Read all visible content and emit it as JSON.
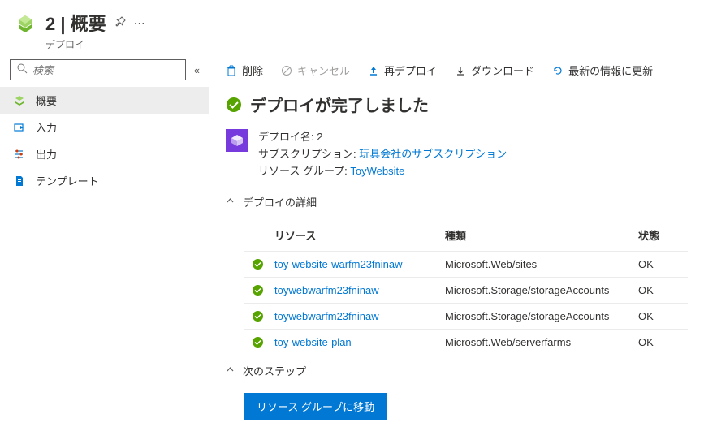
{
  "header": {
    "title": "2 | 概要",
    "subtitle": "デプロイ"
  },
  "search": {
    "placeholder": "検索"
  },
  "sidebar": {
    "items": [
      {
        "label": "概要"
      },
      {
        "label": "入力"
      },
      {
        "label": "出力"
      },
      {
        "label": "テンプレート"
      }
    ]
  },
  "toolbar": {
    "delete": "削除",
    "cancel": "キャンセル",
    "redeploy": "再デプロイ",
    "download": "ダウンロード",
    "refresh": "最新の情報に更新"
  },
  "status": {
    "title": "デプロイが完了しました"
  },
  "details": {
    "deploy_name_label": "デプロイ名: ",
    "deploy_name": "2",
    "subscription_label": "サブスクリプション: ",
    "subscription": "玩具会社のサブスクリプション",
    "resource_group_label": "リソース グループ: ",
    "resource_group": "ToyWebsite"
  },
  "sections": {
    "deploy_details": "デプロイの詳細",
    "next_steps": "次のステップ"
  },
  "table": {
    "headers": {
      "resource": "リソース",
      "type": "種類",
      "state": "状態"
    },
    "rows": [
      {
        "resource": "toy-website-warfm23fninaw",
        "type": "Microsoft.Web/sites",
        "state": "OK"
      },
      {
        "resource": "toywebwarfm23fninaw",
        "type": "Microsoft.Storage/storageAccounts",
        "state": "OK"
      },
      {
        "resource": "toywebwarfm23fninaw",
        "type": "Microsoft.Storage/storageAccounts",
        "state": "OK"
      },
      {
        "resource": "toy-website-plan",
        "type": "Microsoft.Web/serverfarms",
        "state": "OK"
      }
    ]
  },
  "buttons": {
    "goto_resource_group": "リソース グループに移動"
  }
}
